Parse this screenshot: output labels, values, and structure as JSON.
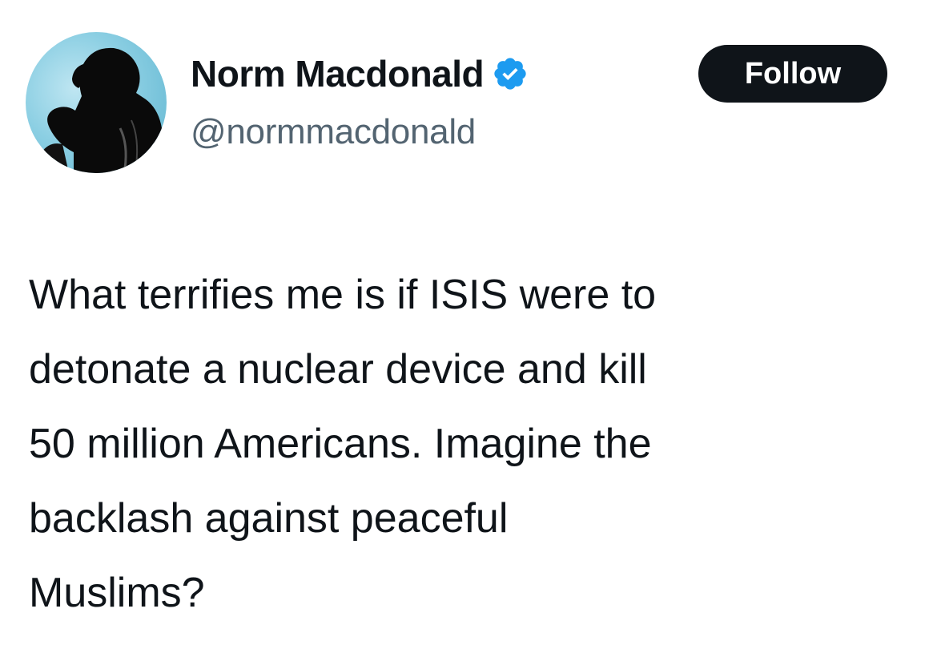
{
  "author": {
    "display_name": "Norm Macdonald",
    "handle": "@normmacdonald",
    "verified": true,
    "verified_color": "#1d9bf0"
  },
  "follow_button": {
    "label": "Follow",
    "bg_color": "#0f1419",
    "text_color": "#ffffff"
  },
  "tweet": {
    "lines": [
      "What terrifies me is if ISIS were to",
      "detonate a nuclear device and kill",
      "50 million Americans. Imagine the",
      "backlash against peaceful",
      "Muslims?"
    ]
  },
  "icons": {
    "avatar": "profile-photo-avatar",
    "verified": "verified-badge-icon"
  }
}
